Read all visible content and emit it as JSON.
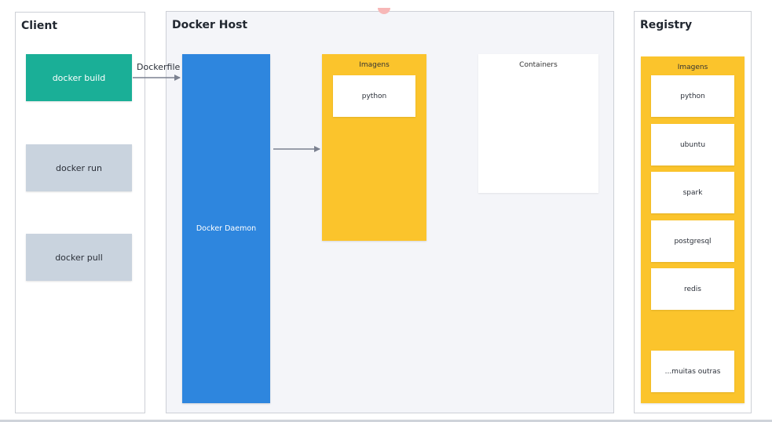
{
  "client": {
    "title": "Client",
    "commands": [
      {
        "label": "docker build"
      },
      {
        "label": "docker run"
      },
      {
        "label": "docker pull"
      }
    ]
  },
  "host": {
    "title": "Docker Host",
    "daemon_label": "Docker Daemon",
    "images_label": "Imagens",
    "images": [
      "python"
    ],
    "containers_label": "Containers"
  },
  "registry": {
    "title": "Registry",
    "images_label": "Imagens",
    "images": [
      "python",
      "ubuntu",
      "spark",
      "postgresql",
      "redis",
      "...muitas outras"
    ]
  },
  "edges": {
    "dockerfile_label": "Dockerfile"
  },
  "colors": {
    "build": "#1aaf97",
    "command": "#c9d3de",
    "daemon": "#2e86de",
    "images": "#fbc42c",
    "host_bg": "#f4f5f9"
  }
}
